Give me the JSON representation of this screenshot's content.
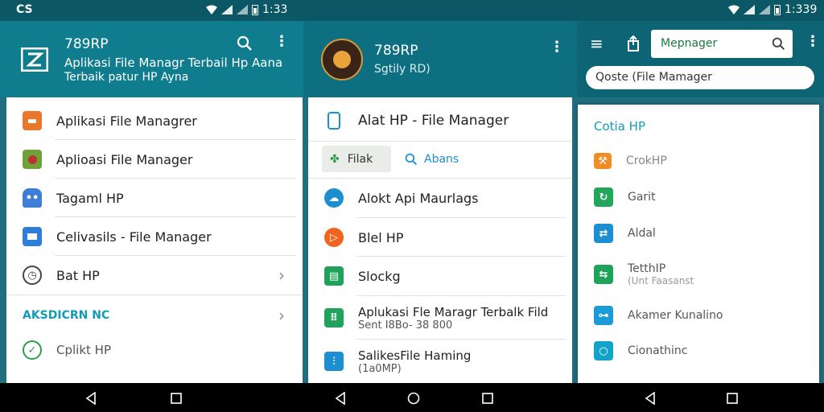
{
  "status_left": {
    "logo_glyph": "CS",
    "time": "1:33"
  },
  "status_right": {
    "time": "1:339"
  },
  "panel1": {
    "title": "789RP",
    "subtitle": "Aplikasi File Managr Terbail Hp Aana",
    "subtitle2": "Terbaik patur HP Ayna",
    "items": [
      {
        "label": "Aplikasi File Managrer",
        "icon": "briefcase-icon",
        "color": "#e8782c"
      },
      {
        "label": "Aplioasi File Manager",
        "icon": "bug-icon",
        "color": "#6fa13a"
      },
      {
        "label": "Tagaml HP",
        "icon": "robot-icon",
        "color": "#3d7fd6"
      },
      {
        "label": "Celivasils - File Manager",
        "icon": "folder-icon",
        "color": "#2f7fd8"
      },
      {
        "label": "Bat HP",
        "icon": "clock-icon",
        "color": "#ffffff"
      }
    ],
    "section_title": "AKSDICRN NC",
    "section_items": [
      {
        "label": "Cplikt HP",
        "icon": "leaf-icon",
        "color": "#2e9d4c"
      }
    ],
    "accent": "#129bb2"
  },
  "panel2": {
    "title": "789RP",
    "subtitle": "Sgtily RD)",
    "header_item": "Alat HP - File Manager",
    "chip_label": "Filak",
    "search_label": "Abans",
    "items": [
      {
        "label": "Alokt Api Maurlags",
        "icon": "cloud-icon",
        "color": "#1d8fd1"
      },
      {
        "label": "Blel HP",
        "icon": "play-icon",
        "color": "#f0641f"
      },
      {
        "label": "Slockg",
        "icon": "sheet-icon",
        "color": "#1fa25a"
      },
      {
        "label": "Aplukasi Fle Maragr Terbalk Fild",
        "sub": "Sent I8Bo- 38 800",
        "icon": "grid-icon",
        "color": "#1fa25a"
      },
      {
        "label": "SalikesFile Haming",
        "sub": "(1a0MP)",
        "icon": "equalizer-icon",
        "color": "#1d8fd1"
      }
    ]
  },
  "panel3": {
    "search_placeholder": "Mepnager",
    "secondary_search": "Qoste (File Mamager",
    "section_title": "Cotia HP",
    "items": [
      {
        "label": "CrokHP",
        "icon": "tools-icon",
        "color": "#f08c25"
      },
      {
        "label": "Garit",
        "icon": "refresh-icon",
        "color": "#22a65a"
      },
      {
        "label": "Aldal",
        "icon": "share-icon",
        "color": "#1d8fd1"
      },
      {
        "label": "TetthIP",
        "sub": "(Unt Faasanst",
        "icon": "arrows-icon",
        "color": "#1fa25a"
      },
      {
        "label": "Akamer Kunalino",
        "icon": "link-icon",
        "color": "#1d9bd6"
      },
      {
        "label": "Cionathinc",
        "icon": "circle-icon",
        "color": "#13a3c8"
      }
    ]
  }
}
